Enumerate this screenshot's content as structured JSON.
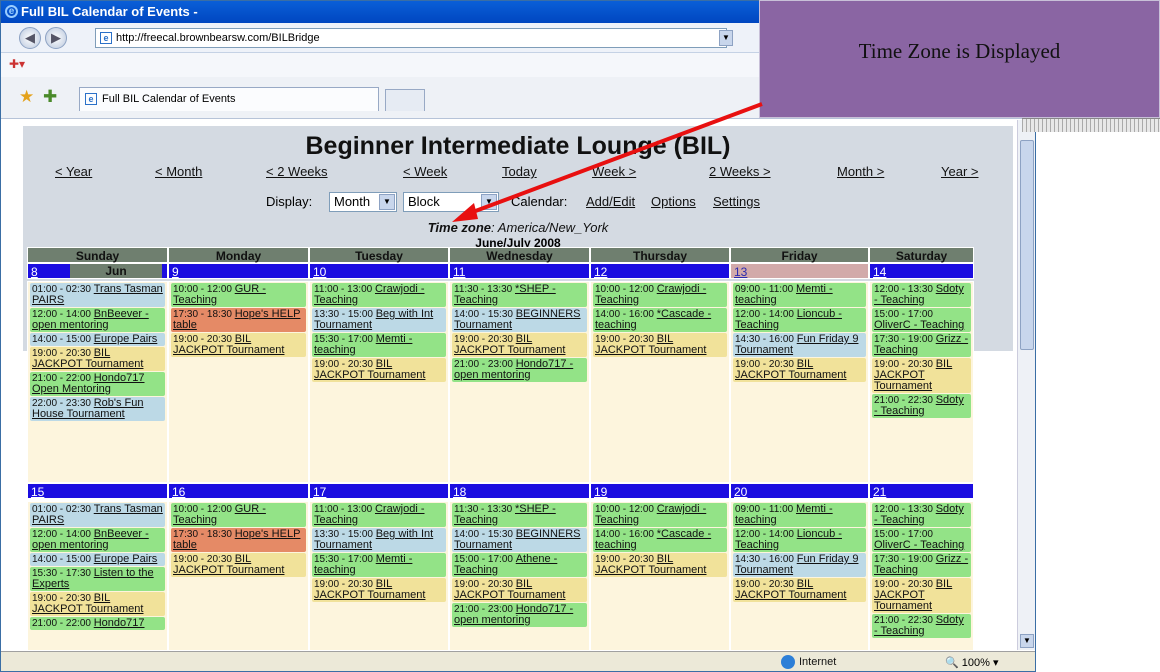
{
  "browser": {
    "title": "Full BIL Calendar of Events -",
    "url": "http://freecal.brownbearsw.com/BILBridge",
    "tab_label": "Full BIL Calendar of Events",
    "status_zone": "Internet",
    "zoom": "100%"
  },
  "callout": {
    "text": "Time Zone is Displayed"
  },
  "cal": {
    "heading": "Beginner Intermediate Lounge (BIL)",
    "nav": [
      "< Year",
      "< Month",
      "< 2 Weeks",
      "< Week",
      "Today",
      "Week >",
      "2 Weeks >",
      "Month >",
      "Year >"
    ],
    "display_label": "Display:",
    "display_mode": "Month",
    "display_style": "Block",
    "calendar_label": "Calendar:",
    "add_edit": "Add/Edit",
    "options": "Options",
    "settings": "Settings",
    "tz_label": "Time zone",
    "tz_value": ": America/New_York",
    "month_label": "June/July 2008",
    "days": [
      "Sunday",
      "Monday",
      "Tuesday",
      "Wednesday",
      "Thursday",
      "Friday",
      "Saturday"
    ],
    "jun": "Jun",
    "week1": {
      "dates": [
        "8",
        "9",
        "10",
        "11",
        "12",
        "13",
        "14"
      ],
      "sun": [
        [
          "01:00 - 02:30 ",
          "Trans Tasman PAIRS"
        ],
        [
          "12:00 - 14:00 ",
          "BnBeever - open mentoring"
        ],
        [
          "14:00 - 15:00 ",
          "Europe Pairs"
        ],
        [
          "19:00 - 20:30 ",
          "BIL JACKPOT Tournament"
        ],
        [
          "21:00 - 22:00 ",
          "Hondo717 Open Mentoring"
        ],
        [
          "22:00 - 23:30 ",
          "Rob's Fun House Tournament"
        ]
      ],
      "mon": [
        [
          "10:00 - 12:00 ",
          "GUR - Teaching"
        ],
        [
          "17:30 - 18:30 ",
          "Hope's HELP table"
        ],
        [
          "19:00 - 20:30 ",
          "BIL JACKPOT Tournament"
        ]
      ],
      "tue": [
        [
          "11:00 - 13:00 ",
          "Crawjodi - Teaching"
        ],
        [
          "13:30 - 15:00 ",
          "Beg with Int Tournament"
        ],
        [
          "15:30 - 17:00 ",
          "Memti - teaching"
        ],
        [
          "19:00 - 20:30 ",
          "BIL JACKPOT Tournament"
        ]
      ],
      "wed": [
        [
          "11:30 - 13:30 ",
          "*SHEP - Teaching"
        ],
        [
          "14:00 - 15:30 ",
          "BEGINNERS Tournament"
        ],
        [
          "19:00 - 20:30 ",
          "BIL JACKPOT Tournament"
        ],
        [
          "21:00 - 23:00 ",
          "Hondo717 - open mentoring"
        ]
      ],
      "thu": [
        [
          "10:00 - 12:00 ",
          "Crawjodi - Teaching"
        ],
        [
          "14:00 - 16:00 ",
          "*Cascade - teaching"
        ],
        [
          "19:00 - 20:30 ",
          "BIL JACKPOT Tournament"
        ]
      ],
      "fri": [
        [
          "09:00 - 11:00 ",
          "Memti - teaching"
        ],
        [
          "12:00 - 14:00 ",
          "Lioncub - Teaching"
        ],
        [
          "14:30 - 16:00 ",
          "Fun Friday 9 Tournament"
        ],
        [
          "19:00 - 20:30 ",
          "BIL JACKPOT Tournament"
        ]
      ],
      "sat": [
        [
          "12:00 - 13:30 ",
          "Sdoty - Teaching"
        ],
        [
          "15:00 - 17:00 ",
          "OliverC - Teaching"
        ],
        [
          "17:30 - 19:00 ",
          "Grizz - Teaching"
        ],
        [
          "19:00 - 20:30 ",
          "BIL JACKPOT Tournament"
        ],
        [
          "21:00 - 22:30 ",
          "Sdoty - Teaching"
        ]
      ]
    },
    "week2": {
      "dates": [
        "15",
        "16",
        "17",
        "18",
        "19",
        "20",
        "21"
      ],
      "sun": [
        [
          "01:00 - 02:30 ",
          "Trans Tasman PAIRS"
        ],
        [
          "12:00 - 14:00 ",
          "BnBeever - open mentoring"
        ],
        [
          "14:00 - 15:00 ",
          "Europe Pairs"
        ],
        [
          "15:30 - 17:30 ",
          "Listen to the Experts"
        ],
        [
          "19:00 - 20:30 ",
          "BIL JACKPOT Tournament"
        ],
        [
          "21:00 - 22:00 ",
          "Hondo717"
        ]
      ],
      "mon": [
        [
          "10:00 - 12:00 ",
          "GUR - Teaching"
        ],
        [
          "17:30 - 18:30 ",
          "Hope's HELP table"
        ],
        [
          "19:00 - 20:30 ",
          "BIL JACKPOT Tournament"
        ]
      ],
      "tue": [
        [
          "11:00 - 13:00 ",
          "Crawjodi - Teaching"
        ],
        [
          "13:30 - 15:00 ",
          "Beg with Int Tournament"
        ],
        [
          "15:30 - 17:00 ",
          "Memti - teaching"
        ],
        [
          "19:00 - 20:30 ",
          "BIL JACKPOT Tournament"
        ]
      ],
      "wed": [
        [
          "11:30 - 13:30 ",
          "*SHEP - Teaching"
        ],
        [
          "14:00 - 15:30 ",
          "BEGINNERS Tournament"
        ],
        [
          "15:00 - 17:00 ",
          "Athene - Teaching"
        ],
        [
          "19:00 - 20:30 ",
          "BIL JACKPOT Tournament"
        ],
        [
          "21:00 - 23:00 ",
          "Hondo717 - open mentoring"
        ]
      ],
      "thu": [
        [
          "10:00 - 12:00 ",
          "Crawjodi - Teaching"
        ],
        [
          "14:00 - 16:00 ",
          "*Cascade - teaching"
        ],
        [
          "19:00 - 20:30 ",
          "BIL JACKPOT Tournament"
        ]
      ],
      "fri": [
        [
          "09:00 - 11:00 ",
          "Memti - teaching"
        ],
        [
          "12:00 - 14:00 ",
          "Lioncub - Teaching"
        ],
        [
          "14:30 - 16:00 ",
          "Fun Friday 9 Tournament"
        ],
        [
          "19:00 - 20:30 ",
          "BIL JACKPOT Tournament"
        ]
      ],
      "sat": [
        [
          "12:00 - 13:30 ",
          "Sdoty - Teaching"
        ],
        [
          "15:00 - 17:00 ",
          "OliverC - Teaching"
        ],
        [
          "17:30 - 19:00 ",
          "Grizz - Teaching"
        ],
        [
          "19:00 - 20:30 ",
          "BIL JACKPOT Tournament"
        ],
        [
          "21:00 - 22:30 ",
          "Sdoty - Teaching"
        ]
      ]
    },
    "colors": {
      "week1": {
        "sun": [
          "b",
          "g",
          "b",
          "y",
          "g",
          "b"
        ],
        "mon": [
          "g",
          "r",
          "y"
        ],
        "tue": [
          "g",
          "b",
          "g",
          "y"
        ],
        "wed": [
          "g",
          "b",
          "y",
          "g"
        ],
        "thu": [
          "g",
          "g",
          "y"
        ],
        "fri": [
          "g",
          "g",
          "b",
          "y"
        ],
        "sat": [
          "g",
          "g",
          "g",
          "y",
          "g"
        ]
      },
      "week2": {
        "sun": [
          "b",
          "g",
          "b",
          "g",
          "y",
          "g"
        ],
        "mon": [
          "g",
          "r",
          "y"
        ],
        "tue": [
          "g",
          "b",
          "g",
          "y"
        ],
        "wed": [
          "g",
          "b",
          "g",
          "y",
          "g"
        ],
        "thu": [
          "g",
          "g",
          "y"
        ],
        "fri": [
          "g",
          "g",
          "b",
          "y"
        ],
        "sat": [
          "g",
          "g",
          "g",
          "y",
          "g"
        ]
      }
    }
  }
}
